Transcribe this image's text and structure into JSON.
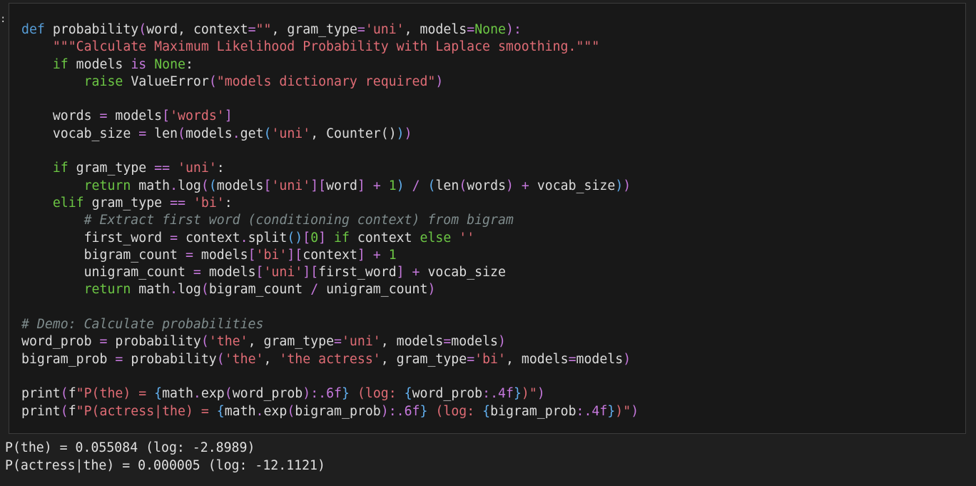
{
  "cell": {
    "code_lines": [
      {
        "tokens": [
          {
            "t": "def ",
            "c": "c-def"
          },
          {
            "t": "probability",
            "c": "c-white"
          },
          {
            "t": "(",
            "c": "c-pur"
          },
          {
            "t": "word",
            "c": "c-white"
          },
          {
            "t": ", ",
            "c": "c-white"
          },
          {
            "t": "context",
            "c": "c-white"
          },
          {
            "t": "=",
            "c": "c-pur"
          },
          {
            "t": "\"\"",
            "c": "c-red"
          },
          {
            "t": ", ",
            "c": "c-white"
          },
          {
            "t": "gram_type",
            "c": "c-white"
          },
          {
            "t": "=",
            "c": "c-pur"
          },
          {
            "t": "'uni'",
            "c": "c-red"
          },
          {
            "t": ", ",
            "c": "c-white"
          },
          {
            "t": "models",
            "c": "c-white"
          },
          {
            "t": "=",
            "c": "c-pur"
          },
          {
            "t": "None",
            "c": "c-green"
          },
          {
            "t": "):",
            "c": "c-pur"
          }
        ]
      },
      {
        "tokens": [
          {
            "t": "    ",
            "c": "c-white"
          },
          {
            "t": "\"\"\"Calculate Maximum Likelihood Probability with Laplace smoothing.\"\"\"",
            "c": "c-red"
          }
        ]
      },
      {
        "tokens": [
          {
            "t": "    ",
            "c": "c-white"
          },
          {
            "t": "if ",
            "c": "c-green"
          },
          {
            "t": "models ",
            "c": "c-white"
          },
          {
            "t": "is ",
            "c": "c-pur"
          },
          {
            "t": "None",
            "c": "c-green"
          },
          {
            "t": ":",
            "c": "c-white"
          }
        ]
      },
      {
        "tokens": [
          {
            "t": "        ",
            "c": "c-white"
          },
          {
            "t": "raise ",
            "c": "c-green"
          },
          {
            "t": "ValueError",
            "c": "c-white"
          },
          {
            "t": "(",
            "c": "c-pur"
          },
          {
            "t": "\"models dictionary required\"",
            "c": "c-red"
          },
          {
            "t": ")",
            "c": "c-pur"
          }
        ]
      },
      {
        "tokens": []
      },
      {
        "tokens": [
          {
            "t": "    ",
            "c": "c-white"
          },
          {
            "t": "words ",
            "c": "c-white"
          },
          {
            "t": "= ",
            "c": "c-pur"
          },
          {
            "t": "models",
            "c": "c-white"
          },
          {
            "t": "[",
            "c": "c-pur"
          },
          {
            "t": "'words'",
            "c": "c-red"
          },
          {
            "t": "]",
            "c": "c-pur"
          }
        ]
      },
      {
        "tokens": [
          {
            "t": "    ",
            "c": "c-white"
          },
          {
            "t": "vocab_size ",
            "c": "c-white"
          },
          {
            "t": "= ",
            "c": "c-pur"
          },
          {
            "t": "len",
            "c": "c-white"
          },
          {
            "t": "(",
            "c": "c-pur"
          },
          {
            "t": "models",
            "c": "c-white"
          },
          {
            "t": ".",
            "c": "c-pur"
          },
          {
            "t": "get",
            "c": "c-white"
          },
          {
            "t": "(",
            "c": "c-blue"
          },
          {
            "t": "'uni'",
            "c": "c-red"
          },
          {
            "t": ", ",
            "c": "c-white"
          },
          {
            "t": "Counter",
            "c": "c-white"
          },
          {
            "t": "()",
            "c": "c-white"
          },
          {
            "t": ")",
            "c": "c-blue"
          },
          {
            "t": ")",
            "c": "c-pur"
          }
        ]
      },
      {
        "tokens": []
      },
      {
        "tokens": [
          {
            "t": "    ",
            "c": "c-white"
          },
          {
            "t": "if ",
            "c": "c-green"
          },
          {
            "t": "gram_type ",
            "c": "c-white"
          },
          {
            "t": "== ",
            "c": "c-pur"
          },
          {
            "t": "'uni'",
            "c": "c-red"
          },
          {
            "t": ":",
            "c": "c-white"
          }
        ]
      },
      {
        "tokens": [
          {
            "t": "        ",
            "c": "c-white"
          },
          {
            "t": "return ",
            "c": "c-green"
          },
          {
            "t": "math",
            "c": "c-white"
          },
          {
            "t": ".",
            "c": "c-pur"
          },
          {
            "t": "log",
            "c": "c-white"
          },
          {
            "t": "(",
            "c": "c-pur"
          },
          {
            "t": "(",
            "c": "c-blue"
          },
          {
            "t": "models",
            "c": "c-white"
          },
          {
            "t": "[",
            "c": "c-pur"
          },
          {
            "t": "'uni'",
            "c": "c-red"
          },
          {
            "t": "]",
            "c": "c-pur"
          },
          {
            "t": "[",
            "c": "c-pur"
          },
          {
            "t": "word",
            "c": "c-white"
          },
          {
            "t": "] ",
            "c": "c-pur"
          },
          {
            "t": "+ ",
            "c": "c-pur"
          },
          {
            "t": "1",
            "c": "c-green"
          },
          {
            "t": ") ",
            "c": "c-blue"
          },
          {
            "t": "/ ",
            "c": "c-pur"
          },
          {
            "t": "(",
            "c": "c-blue"
          },
          {
            "t": "len",
            "c": "c-white"
          },
          {
            "t": "(",
            "c": "c-pur"
          },
          {
            "t": "words",
            "c": "c-white"
          },
          {
            "t": ") ",
            "c": "c-pur"
          },
          {
            "t": "+ ",
            "c": "c-pur"
          },
          {
            "t": "vocab_size",
            "c": "c-white"
          },
          {
            "t": ")",
            "c": "c-blue"
          },
          {
            "t": ")",
            "c": "c-pur"
          }
        ]
      },
      {
        "tokens": [
          {
            "t": "    ",
            "c": "c-white"
          },
          {
            "t": "elif ",
            "c": "c-green"
          },
          {
            "t": "gram_type ",
            "c": "c-white"
          },
          {
            "t": "== ",
            "c": "c-pur"
          },
          {
            "t": "'bi'",
            "c": "c-red"
          },
          {
            "t": ":",
            "c": "c-white"
          }
        ]
      },
      {
        "tokens": [
          {
            "t": "        ",
            "c": "c-white"
          },
          {
            "t": "# Extract first word (conditioning context) from bigram",
            "c": "c-gray"
          }
        ]
      },
      {
        "tokens": [
          {
            "t": "        ",
            "c": "c-white"
          },
          {
            "t": "first_word ",
            "c": "c-white"
          },
          {
            "t": "= ",
            "c": "c-pur"
          },
          {
            "t": "context",
            "c": "c-white"
          },
          {
            "t": ".",
            "c": "c-pur"
          },
          {
            "t": "split",
            "c": "c-white"
          },
          {
            "t": "()",
            "c": "c-blue"
          },
          {
            "t": "[",
            "c": "c-pur"
          },
          {
            "t": "0",
            "c": "c-green"
          },
          {
            "t": "] ",
            "c": "c-pur"
          },
          {
            "t": "if ",
            "c": "c-green"
          },
          {
            "t": "context ",
            "c": "c-white"
          },
          {
            "t": "else ",
            "c": "c-green"
          },
          {
            "t": "''",
            "c": "c-red"
          }
        ]
      },
      {
        "tokens": [
          {
            "t": "        ",
            "c": "c-white"
          },
          {
            "t": "bigram_count ",
            "c": "c-white"
          },
          {
            "t": "= ",
            "c": "c-pur"
          },
          {
            "t": "models",
            "c": "c-white"
          },
          {
            "t": "[",
            "c": "c-pur"
          },
          {
            "t": "'bi'",
            "c": "c-red"
          },
          {
            "t": "]",
            "c": "c-pur"
          },
          {
            "t": "[",
            "c": "c-pur"
          },
          {
            "t": "context",
            "c": "c-white"
          },
          {
            "t": "] ",
            "c": "c-pur"
          },
          {
            "t": "+ ",
            "c": "c-pur"
          },
          {
            "t": "1",
            "c": "c-green"
          }
        ]
      },
      {
        "tokens": [
          {
            "t": "        ",
            "c": "c-white"
          },
          {
            "t": "unigram_count ",
            "c": "c-white"
          },
          {
            "t": "= ",
            "c": "c-pur"
          },
          {
            "t": "models",
            "c": "c-white"
          },
          {
            "t": "[",
            "c": "c-pur"
          },
          {
            "t": "'uni'",
            "c": "c-red"
          },
          {
            "t": "]",
            "c": "c-pur"
          },
          {
            "t": "[",
            "c": "c-pur"
          },
          {
            "t": "first_word",
            "c": "c-white"
          },
          {
            "t": "] ",
            "c": "c-pur"
          },
          {
            "t": "+ ",
            "c": "c-pur"
          },
          {
            "t": "vocab_size",
            "c": "c-white"
          }
        ]
      },
      {
        "tokens": [
          {
            "t": "        ",
            "c": "c-white"
          },
          {
            "t": "return ",
            "c": "c-green"
          },
          {
            "t": "math",
            "c": "c-white"
          },
          {
            "t": ".",
            "c": "c-pur"
          },
          {
            "t": "log",
            "c": "c-white"
          },
          {
            "t": "(",
            "c": "c-pur"
          },
          {
            "t": "bigram_count ",
            "c": "c-white"
          },
          {
            "t": "/ ",
            "c": "c-pur"
          },
          {
            "t": "unigram_count",
            "c": "c-white"
          },
          {
            "t": ")",
            "c": "c-pur"
          }
        ]
      },
      {
        "tokens": []
      },
      {
        "tokens": [
          {
            "t": "# Demo: Calculate probabilities",
            "c": "c-gray"
          }
        ]
      },
      {
        "tokens": [
          {
            "t": "word_prob ",
            "c": "c-white"
          },
          {
            "t": "= ",
            "c": "c-pur"
          },
          {
            "t": "probability",
            "c": "c-white"
          },
          {
            "t": "(",
            "c": "c-pur"
          },
          {
            "t": "'the'",
            "c": "c-red"
          },
          {
            "t": ", ",
            "c": "c-white"
          },
          {
            "t": "gram_type",
            "c": "c-white"
          },
          {
            "t": "=",
            "c": "c-pur"
          },
          {
            "t": "'uni'",
            "c": "c-red"
          },
          {
            "t": ", ",
            "c": "c-white"
          },
          {
            "t": "models",
            "c": "c-white"
          },
          {
            "t": "=",
            "c": "c-pur"
          },
          {
            "t": "models",
            "c": "c-white"
          },
          {
            "t": ")",
            "c": "c-pur"
          }
        ]
      },
      {
        "tokens": [
          {
            "t": "bigram_prob ",
            "c": "c-white"
          },
          {
            "t": "= ",
            "c": "c-pur"
          },
          {
            "t": "probability",
            "c": "c-white"
          },
          {
            "t": "(",
            "c": "c-pur"
          },
          {
            "t": "'the'",
            "c": "c-red"
          },
          {
            "t": ", ",
            "c": "c-white"
          },
          {
            "t": "'the actress'",
            "c": "c-red"
          },
          {
            "t": ", ",
            "c": "c-white"
          },
          {
            "t": "gram_type",
            "c": "c-white"
          },
          {
            "t": "=",
            "c": "c-pur"
          },
          {
            "t": "'bi'",
            "c": "c-red"
          },
          {
            "t": ", ",
            "c": "c-white"
          },
          {
            "t": "models",
            "c": "c-white"
          },
          {
            "t": "=",
            "c": "c-pur"
          },
          {
            "t": "models",
            "c": "c-white"
          },
          {
            "t": ")",
            "c": "c-pur"
          }
        ]
      },
      {
        "tokens": []
      },
      {
        "tokens": [
          {
            "t": "print",
            "c": "c-white"
          },
          {
            "t": "(",
            "c": "c-pur"
          },
          {
            "t": "f",
            "c": "c-white"
          },
          {
            "t": "\"P(the) = ",
            "c": "c-red"
          },
          {
            "t": "{",
            "c": "c-blue"
          },
          {
            "t": "math",
            "c": "c-white"
          },
          {
            "t": ".",
            "c": "c-pur"
          },
          {
            "t": "exp",
            "c": "c-white"
          },
          {
            "t": "(",
            "c": "c-pur"
          },
          {
            "t": "word_prob",
            "c": "c-white"
          },
          {
            "t": ")",
            "c": "c-pur"
          },
          {
            "t": ":.6f",
            "c": "c-pur"
          },
          {
            "t": "}",
            "c": "c-blue"
          },
          {
            "t": " (log: ",
            "c": "c-red"
          },
          {
            "t": "{",
            "c": "c-blue"
          },
          {
            "t": "word_prob",
            "c": "c-white"
          },
          {
            "t": ":.4f",
            "c": "c-pur"
          },
          {
            "t": "}",
            "c": "c-blue"
          },
          {
            "t": ")\"",
            "c": "c-red"
          },
          {
            "t": ")",
            "c": "c-pur"
          }
        ]
      },
      {
        "tokens": [
          {
            "t": "print",
            "c": "c-white"
          },
          {
            "t": "(",
            "c": "c-pur"
          },
          {
            "t": "f",
            "c": "c-white"
          },
          {
            "t": "\"P(actress|the) = ",
            "c": "c-red"
          },
          {
            "t": "{",
            "c": "c-blue"
          },
          {
            "t": "math",
            "c": "c-white"
          },
          {
            "t": ".",
            "c": "c-pur"
          },
          {
            "t": "exp",
            "c": "c-white"
          },
          {
            "t": "(",
            "c": "c-pur"
          },
          {
            "t": "bigram_prob",
            "c": "c-white"
          },
          {
            "t": ")",
            "c": "c-pur"
          },
          {
            "t": ":.6f",
            "c": "c-pur"
          },
          {
            "t": "}",
            "c": "c-blue"
          },
          {
            "t": " (log: ",
            "c": "c-red"
          },
          {
            "t": "{",
            "c": "c-blue"
          },
          {
            "t": "bigram_prob",
            "c": "c-white"
          },
          {
            "t": ":.4f",
            "c": "c-pur"
          },
          {
            "t": "}",
            "c": "c-blue"
          },
          {
            "t": ")\"",
            "c": "c-red"
          },
          {
            "t": ")",
            "c": "c-pur"
          }
        ]
      }
    ]
  },
  "gutter_mark": ":",
  "output": {
    "lines": [
      "P(the) = 0.055084 (log: -2.8989)",
      "P(actress|the) = 0.000005 (log: -12.1121)"
    ]
  }
}
